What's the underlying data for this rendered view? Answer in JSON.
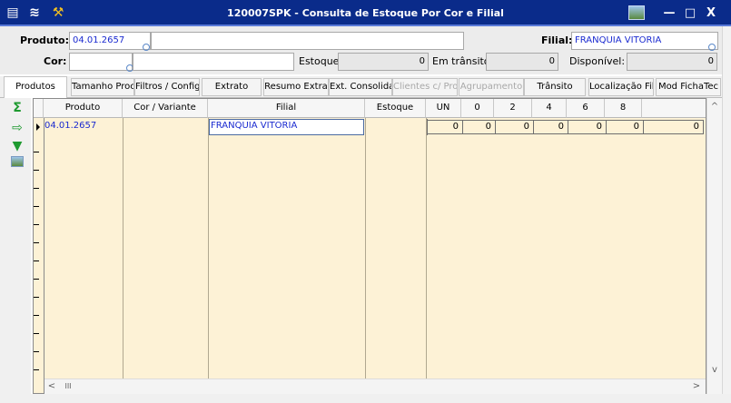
{
  "window": {
    "title": "120007SPK - Consulta de Estoque Por Cor e Filial",
    "menu_icon": "list-icon",
    "tool_icon": "wrench-icon",
    "image_icon": "picture-icon",
    "minimize_label": "—",
    "maximize_label": "□",
    "close_label": "X"
  },
  "form": {
    "produto_label": "Produto:",
    "produto_value": "04.01.2657",
    "filial_label": "Filial:",
    "filial_value": "FRANQUIA VITORIA",
    "cor_label": "Cor:",
    "cor_value": "",
    "estoque_label": "Estoque:",
    "estoque_value": "0",
    "em_transito_label": "Em trânsito:",
    "em_transito_value": "0",
    "disponivel_label": "Disponível:",
    "disponivel_value": "0"
  },
  "tabs": [
    {
      "label": "Produtos",
      "active": true,
      "enabled": true
    },
    {
      "label": "Tamanho Proc",
      "active": false,
      "enabled": true
    },
    {
      "label": "Filtros / Config",
      "active": false,
      "enabled": true
    },
    {
      "label": "Extrato",
      "active": false,
      "enabled": true
    },
    {
      "label": "Resumo Extra",
      "active": false,
      "enabled": true
    },
    {
      "label": "Ext. Consolida",
      "active": false,
      "enabled": true
    },
    {
      "label": "Clientes c/ Pro",
      "active": false,
      "enabled": false
    },
    {
      "label": "Agrupamento",
      "active": false,
      "enabled": false
    },
    {
      "label": "Trânsito",
      "active": false,
      "enabled": true
    },
    {
      "label": "Localização Fil",
      "active": false,
      "enabled": true
    },
    {
      "label": "Mod FichaTec",
      "active": false,
      "enabled": true
    }
  ],
  "sidebar_icons": [
    "sum-icon",
    "export-icon",
    "collapse-down-icon",
    "picture-icon"
  ],
  "grid": {
    "columns": [
      "Produto",
      "Cor / Variante",
      "Filial",
      "Estoque",
      "UN",
      "0",
      "2",
      "4",
      "6",
      "8"
    ],
    "rows": [
      {
        "produto": "04.01.2657",
        "cor": "",
        "filial": "FRANQUIA VITORIA",
        "estoque": "",
        "sizes": [
          "0",
          "0",
          "0",
          "0",
          "0",
          "0",
          "0"
        ]
      }
    ]
  },
  "scroll": {
    "up": "^",
    "down": "v",
    "left": "<",
    "right": ">",
    "thumb": "III"
  },
  "colors": {
    "titlebar": "#0a2b8a",
    "grid_background": "#fdf2d6",
    "value_text": "#1a2ad0"
  }
}
